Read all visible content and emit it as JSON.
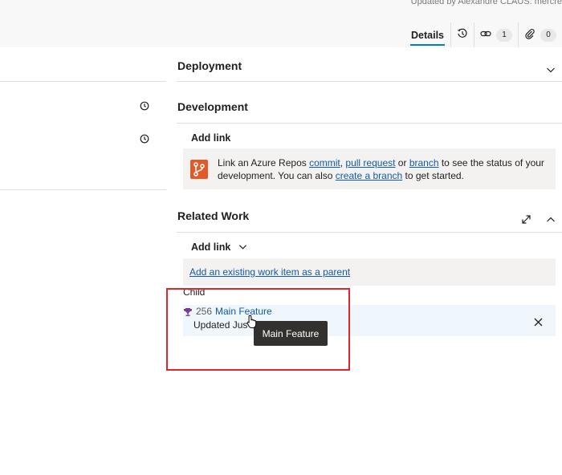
{
  "header": {
    "updated_by": "Updated by Alexandre CLAUS: mercre"
  },
  "toolbar": {
    "details_label": "Details",
    "history_icon": "history-icon",
    "links_count": "1",
    "attachments_count": "0"
  },
  "sections": {
    "deployment": "Deployment",
    "development": "Development",
    "related_work": "Related Work"
  },
  "development": {
    "add_link": "Add link",
    "text_1": "Link an Azure Repos ",
    "link_commit": "commit",
    "text_2": ", ",
    "link_pull_request": "pull request",
    "text_3": " or ",
    "link_branch": "branch",
    "text_4": " to see the status of your development. You can also ",
    "link_create_branch": "create a branch",
    "text_5": " to get started."
  },
  "related_work": {
    "add_link": "Add link",
    "add_parent": "Add an existing work item as a parent",
    "group_label": "Child",
    "child": {
      "id": "256",
      "title": "Main Feature",
      "updated": "Updated Jus"
    }
  },
  "tooltip": {
    "text": "Main Feature"
  },
  "colors": {
    "link": "#0f5ba7",
    "accent": "#0078d4",
    "repo_icon": "#e05b29",
    "highlight_box": "#e0262d",
    "feature_icon": "#773b93"
  }
}
